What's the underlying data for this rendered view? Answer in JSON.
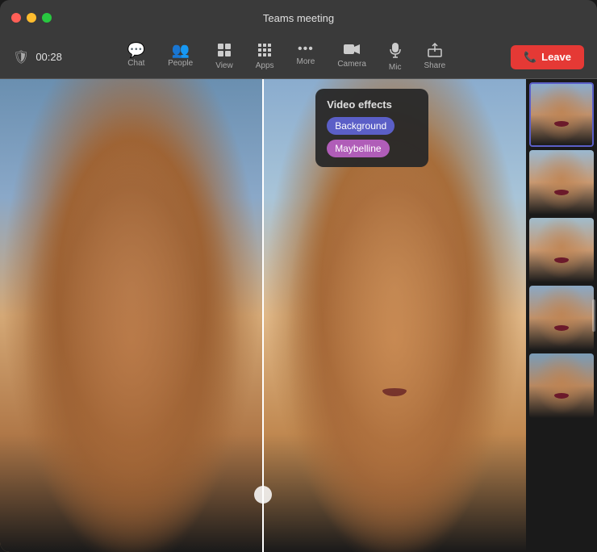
{
  "window": {
    "title": "Teams meeting"
  },
  "traffic_lights": {
    "close": "close",
    "minimize": "minimize",
    "maximize": "maximize"
  },
  "toolbar": {
    "timer": "00:28",
    "items": [
      {
        "id": "chat",
        "icon": "💬",
        "label": "Chat"
      },
      {
        "id": "people",
        "icon": "👥",
        "label": "People"
      },
      {
        "id": "view",
        "icon": "⊞",
        "label": "View"
      },
      {
        "id": "apps",
        "icon": "⧉",
        "label": "Apps"
      },
      {
        "id": "more",
        "icon": "•••",
        "label": "More"
      },
      {
        "id": "camera",
        "icon": "📷",
        "label": "Camera"
      },
      {
        "id": "mic",
        "icon": "🎙",
        "label": "Mic"
      },
      {
        "id": "share",
        "icon": "⬆",
        "label": "Share"
      }
    ],
    "leave_button": "Leave"
  },
  "effects_panel": {
    "title": "Video effects",
    "tabs": [
      {
        "id": "background",
        "label": "Background",
        "active": true
      },
      {
        "id": "maybelline",
        "label": "Maybelline",
        "active": false
      }
    ]
  },
  "thumbnails": [
    {
      "id": "thumb-1",
      "selected": true
    },
    {
      "id": "thumb-2",
      "selected": false
    },
    {
      "id": "thumb-3",
      "selected": false
    },
    {
      "id": "thumb-4",
      "selected": false
    },
    {
      "id": "thumb-5",
      "selected": false
    }
  ],
  "colors": {
    "active_tab": "#5b5fc7",
    "secondary_tab": "#b05db8",
    "leave_button": "#e53935",
    "selected_border": "#5b5fc7"
  }
}
